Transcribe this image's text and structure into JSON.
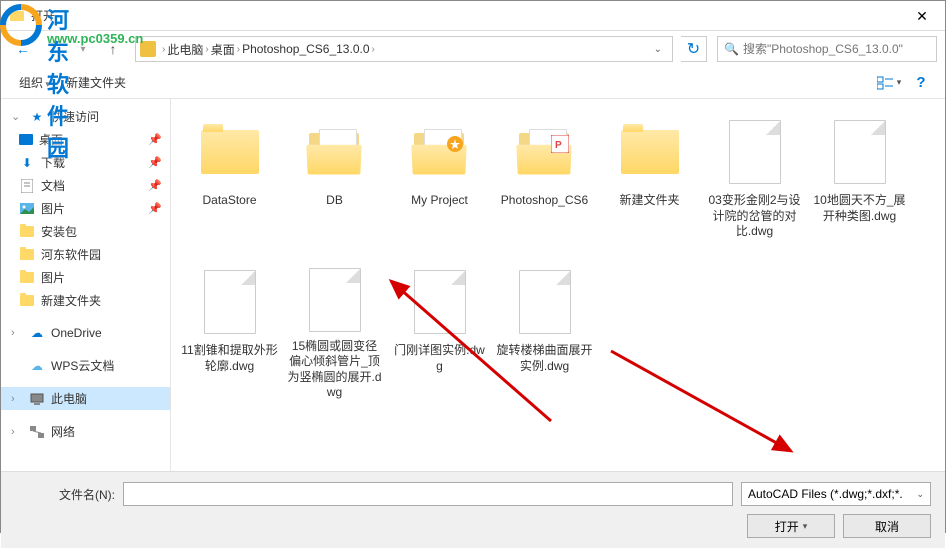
{
  "window": {
    "title": "打开"
  },
  "watermark": {
    "site": "河东软件园",
    "url": "www.pc0359.cn"
  },
  "breadcrumb": {
    "segs": [
      "此电脑",
      "桌面",
      "Photoshop_CS6_13.0.0"
    ]
  },
  "search": {
    "placeholder": "搜索\"Photoshop_CS6_13.0.0\""
  },
  "toolbar": {
    "organize": "组织",
    "newfolder": "新建文件夹"
  },
  "sidebar": {
    "quick": "快速访问",
    "items1": [
      {
        "label": "桌面",
        "pin": true,
        "icon": "desktop"
      },
      {
        "label": "下载",
        "pin": true,
        "icon": "download"
      },
      {
        "label": "文档",
        "pin": true,
        "icon": "document"
      },
      {
        "label": "图片",
        "pin": true,
        "icon": "picture"
      },
      {
        "label": "安装包",
        "pin": false,
        "icon": "folder"
      },
      {
        "label": "河东软件园",
        "pin": false,
        "icon": "folder"
      },
      {
        "label": "图片",
        "pin": false,
        "icon": "folder"
      },
      {
        "label": "新建文件夹",
        "pin": false,
        "icon": "folder"
      }
    ],
    "onedrive": "OneDrive",
    "wps": "WPS云文档",
    "thispc": "此电脑",
    "network": "网络"
  },
  "files": [
    {
      "name": "DataStore",
      "type": "folder"
    },
    {
      "name": "DB",
      "type": "folder-open"
    },
    {
      "name": "My Project",
      "type": "folder-open-badge"
    },
    {
      "name": "Photoshop_CS6",
      "type": "folder-open-ps"
    },
    {
      "name": "新建文件夹",
      "type": "folder"
    },
    {
      "name": "03变形金刚2与设计院的岔管的对比.dwg",
      "type": "file"
    },
    {
      "name": "10地圆天不方_展开种类图.dwg",
      "type": "file"
    },
    {
      "name": "11割锥和提取外形轮廓.dwg",
      "type": "file"
    },
    {
      "name": "15椭圆或圆变径偏心倾斜管片_顶为竖椭圆的展开.dwg",
      "type": "file"
    },
    {
      "name": "门刚详图实例.dwg",
      "type": "file"
    },
    {
      "name": "旋转楼梯曲面展开实例.dwg",
      "type": "file"
    }
  ],
  "bottom": {
    "fname_label": "文件名(N):",
    "filter": "AutoCAD Files (*.dwg;*.dxf;*.",
    "open": "打开",
    "cancel": "取消"
  }
}
